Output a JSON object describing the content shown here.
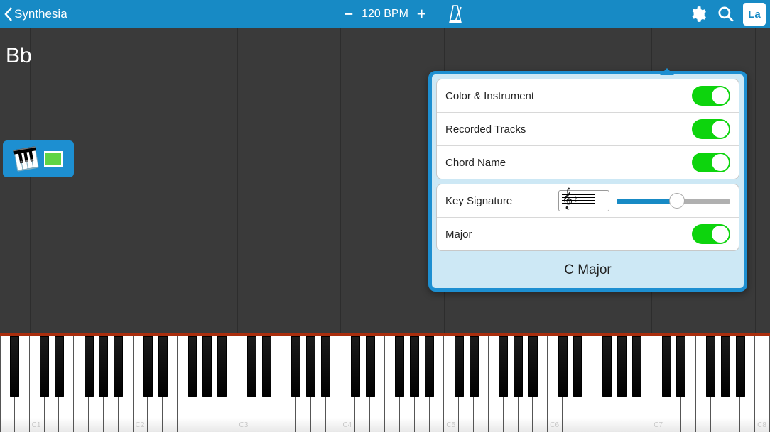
{
  "topbar": {
    "back_label": "Synthesia",
    "tempo_value": "120 BPM",
    "la_label": "La"
  },
  "play": {
    "chord": "Bb"
  },
  "settings": {
    "row1": "Color & Instrument",
    "row2": "Recorded Tracks",
    "row3": "Chord Name",
    "key_sig_label": "Key Signature",
    "major_label": "Major",
    "selected_key": "C Major",
    "toggles": {
      "color_instrument": true,
      "recorded_tracks": true,
      "chord_name": true,
      "major": true
    },
    "slider_percent": 50
  },
  "keyboard": {
    "octaves": 8,
    "labels": [
      "C1",
      "C2",
      "C3",
      "C4",
      "C5",
      "C6",
      "C7",
      "C8"
    ]
  },
  "colors": {
    "accent": "#178ac5",
    "toggle_on": "#0dd40d"
  }
}
